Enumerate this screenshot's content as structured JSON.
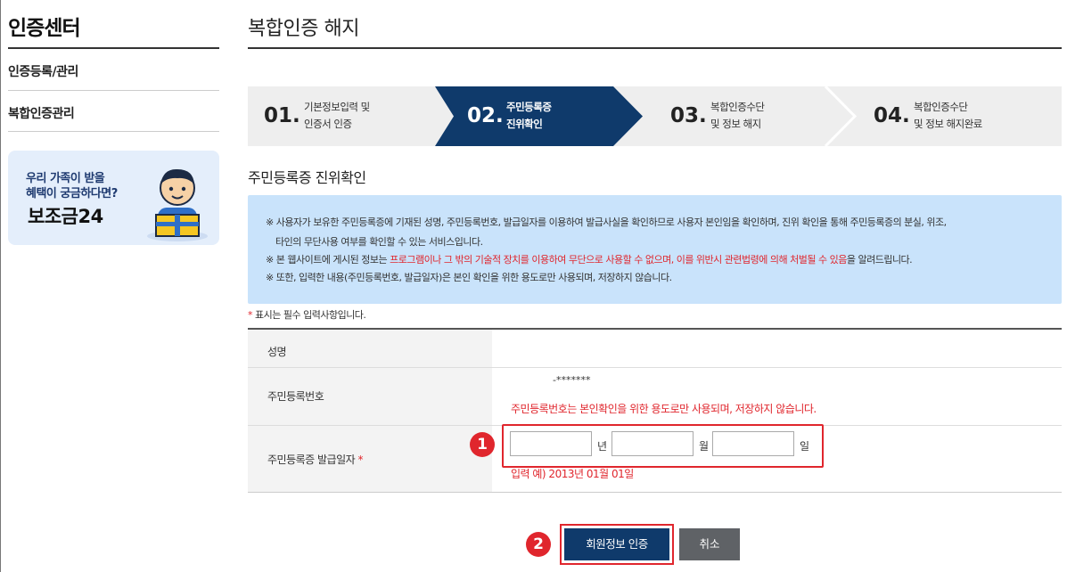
{
  "sidebar": {
    "title": "인증센터",
    "items": [
      {
        "label": "인증등록/관리"
      },
      {
        "label": "복합인증관리"
      }
    ],
    "banner": {
      "line1": "우리 가족이 받을",
      "line2": "혜택이 궁금하다면?",
      "brand": "보조금24"
    }
  },
  "page": {
    "title": "복합인증 해지"
  },
  "steps": [
    {
      "num": "01.",
      "line1": "기본정보입력 및",
      "line2": "인증서 인증",
      "active": false
    },
    {
      "num": "02.",
      "line1": "주민등록증",
      "line2": "진위확인",
      "active": true
    },
    {
      "num": "03.",
      "line1": "복합인증수단",
      "line2": "및 정보 해지",
      "active": false
    },
    {
      "num": "04.",
      "line1": "복합인증수단",
      "line2": "및 정보 해지완료",
      "active": false
    }
  ],
  "section": {
    "title": "주민등록증 진위확인"
  },
  "notice": {
    "line1": "※ 사용자가 보유한 주민등록증에 기재된 성명, 주민등록번호, 발급일자를 이용하여 발급사실을 확인하므로 사용자 본인임을 확인하며, 진위 확인을 통해 주민등록증의 분실, 위조,",
    "line2": "타인의 무단사용 여부를 확인할 수 있는 서비스입니다.",
    "line3_a": "※ 본 웹사이트에 게시된 정보는 ",
    "line3_red": "프로그램이나 그 밖의 기술적 장치를 이용하여 무단으로 사용할 수 없으며, 이를 위반시 관련법령에 의해 처벌될 수 있음",
    "line3_b": "을 알려드립니다.",
    "line4": "※ 또한, 입력한 내용(주민등록번호, 발급일자)은 본인 확인을 위한 용도로만 사용되며, 저장하지 않습니다."
  },
  "form": {
    "required_mark": "*",
    "required_note": "표시는 필수 입력사항입니다.",
    "rows": [
      {
        "label": "성명"
      },
      {
        "label": "주민등록번호"
      },
      {
        "label": "주민등록증 발급일자"
      }
    ],
    "rrn_masked": "-*******",
    "rrn_warning": "주민등록번호는 본인확인을 위한 용도로만 사용되며, 저장하지 않습니다.",
    "date": {
      "year_value": "",
      "year_unit": "년",
      "month_value": "",
      "month_unit": "월",
      "day_value": "",
      "day_unit": "일",
      "example": "입력 예) 2013년 01월 01일"
    }
  },
  "annotations": {
    "badge1": "1",
    "badge2": "2"
  },
  "buttons": {
    "submit": "회원정보 인증",
    "cancel": "취소"
  },
  "colors": {
    "active_step": "#0f3a6b",
    "inactive_step": "#eeeeee",
    "accent_red": "#e0262d",
    "notice_bg": "#c9e3fb",
    "cancel_button": "#5f6266"
  }
}
